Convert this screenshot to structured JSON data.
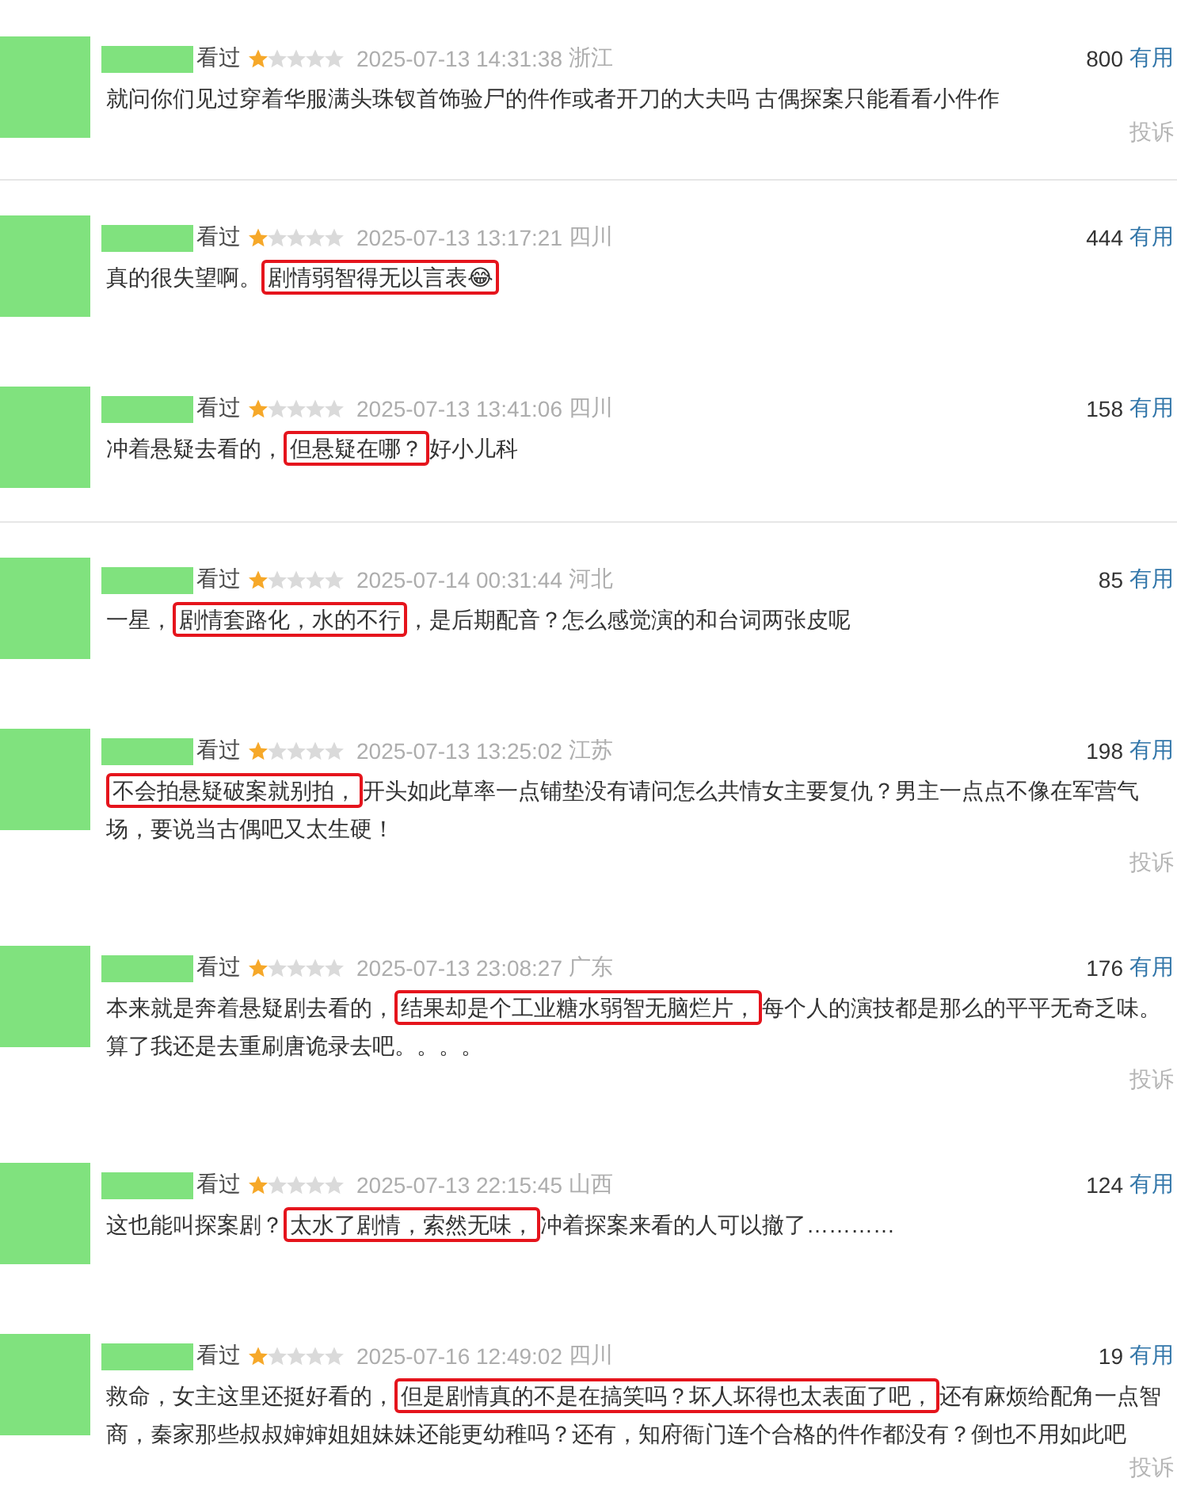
{
  "comments": [
    {
      "watched": "看过",
      "stars": 1,
      "time": "2025-07-13 14:31:38",
      "location": "浙江",
      "votes": "800",
      "useful": "有用",
      "body": [
        {
          "text": "就问你们见过穿着华服满头珠钗首饰验尸的件作或者开刀的大夫吗 古偶探案只能看看小件作",
          "highlighted": false
        }
      ],
      "report": "投诉",
      "divider_below": true
    },
    {
      "watched": "看过",
      "stars": 1,
      "time": "2025-07-13 13:17:21",
      "location": "四川",
      "votes": "444",
      "useful": "有用",
      "body": [
        {
          "text": "真的很失望啊。",
          "highlighted": false
        },
        {
          "text": "剧情弱智得无以言表😂",
          "highlighted": true
        }
      ],
      "divider_below": false
    },
    {
      "watched": "看过",
      "stars": 1,
      "time": "2025-07-13 13:41:06",
      "location": "四川",
      "votes": "158",
      "useful": "有用",
      "body": [
        {
          "text": "冲着悬疑去看的，",
          "highlighted": false
        },
        {
          "text": "但悬疑在哪？",
          "highlighted": true
        },
        {
          "text": "好小儿科",
          "highlighted": false
        }
      ],
      "divider_below": true
    },
    {
      "watched": "看过",
      "stars": 1,
      "time": "2025-07-14 00:31:44",
      "location": "河北",
      "votes": "85",
      "useful": "有用",
      "body": [
        {
          "text": "一星，",
          "highlighted": false
        },
        {
          "text": "剧情套路化，水的不行",
          "highlighted": true
        },
        {
          "text": "，是后期配音？怎么感觉演的和台词两张皮呢",
          "highlighted": false
        }
      ],
      "divider_below": false
    },
    {
      "watched": "看过",
      "stars": 1,
      "time": "2025-07-13 13:25:02",
      "location": "江苏",
      "votes": "198",
      "useful": "有用",
      "body": [
        {
          "text": "不会拍悬疑破案就别拍，",
          "highlighted": true
        },
        {
          "text": "开头如此草率一点铺垫没有请问怎么共情女主要复仇？男主一点点不像在军营气场，要说当古偶吧又太生硬！",
          "highlighted": false
        }
      ],
      "report": "投诉",
      "divider_below": false
    },
    {
      "watched": "看过",
      "stars": 1,
      "time": "2025-07-13 23:08:27",
      "location": "广东",
      "votes": "176",
      "useful": "有用",
      "body": [
        {
          "text": "本来就是奔着悬疑剧去看的，",
          "highlighted": false
        },
        {
          "text": "结果却是个工业糖水弱智无脑烂片，",
          "highlighted": true
        },
        {
          "text": "每个人的演技都是那么的平平无奇乏味。算了我还是去重刷唐诡录去吧。。。。",
          "highlighted": false
        }
      ],
      "report": "投诉",
      "divider_below": false
    },
    {
      "watched": "看过",
      "stars": 1,
      "time": "2025-07-13 22:15:45",
      "location": "山西",
      "votes": "124",
      "useful": "有用",
      "body": [
        {
          "text": "这也能叫探案剧？",
          "highlighted": false
        },
        {
          "text": "太水了剧情，索然无味，",
          "highlighted": true
        },
        {
          "text": "冲着探案来看的人可以撤了…………",
          "highlighted": false
        }
      ],
      "divider_below": false
    },
    {
      "watched": "看过",
      "stars": 1,
      "time": "2025-07-16 12:49:02",
      "location": "四川",
      "votes": "19",
      "useful": "有用",
      "body": [
        {
          "text": "救命，女主这里还挺好看的，",
          "highlighted": false
        },
        {
          "text": "但是剧情真的不是在搞笑吗？坏人坏得也太表面了吧，",
          "highlighted": true
        },
        {
          "text": "还有麻烦给配角一点智商，秦家那些叔叔婶婶姐姐妹妹还能更幼稚吗？还有，知府衙门连个合格的件作都没有？倒也不用如此吧",
          "highlighted": false
        }
      ],
      "report": "投诉",
      "divider_below": false
    }
  ]
}
